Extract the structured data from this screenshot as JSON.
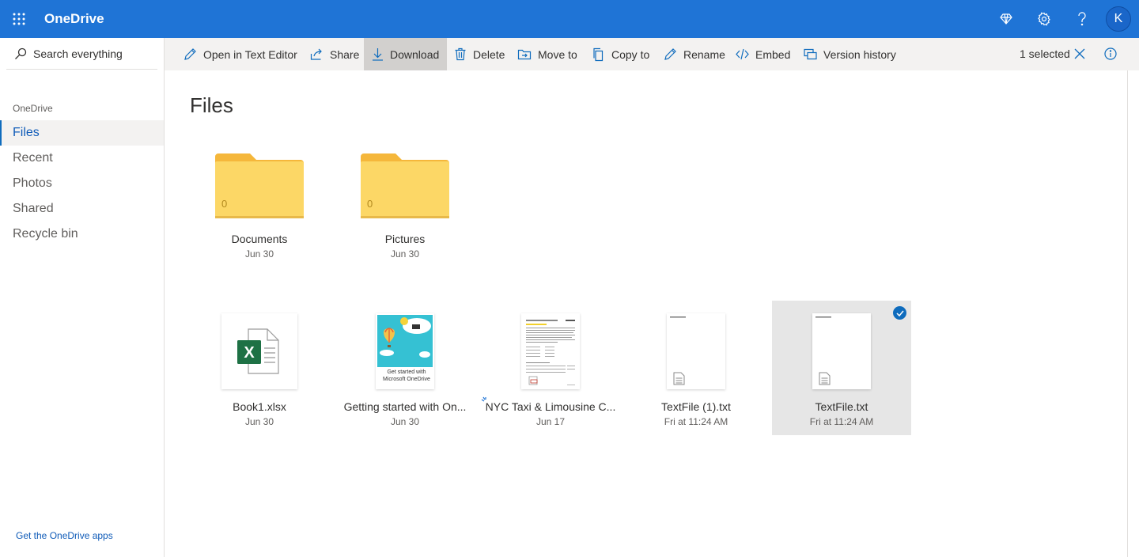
{
  "app": {
    "brand": "OneDrive",
    "avatar_initial": "K",
    "accent_color": "#1f74d6"
  },
  "header": {
    "icons": [
      "waffle-icon",
      "premium-diamond-icon",
      "settings-gear-icon",
      "help-icon"
    ]
  },
  "sidebar": {
    "search_placeholder": "Search everything",
    "section_label": "OneDrive",
    "items": [
      {
        "label": "Files",
        "active": true
      },
      {
        "label": "Recent",
        "active": false
      },
      {
        "label": "Photos",
        "active": false
      },
      {
        "label": "Shared",
        "active": false
      },
      {
        "label": "Recycle bin",
        "active": false
      }
    ],
    "get_apps": "Get the OneDrive apps"
  },
  "commands": {
    "open_text_editor": "Open in Text Editor",
    "share": "Share",
    "download": "Download",
    "delete": "Delete",
    "move_to": "Move to",
    "copy_to": "Copy to",
    "rename": "Rename",
    "embed": "Embed",
    "version_history": "Version history",
    "selected_count": "1 selected"
  },
  "main": {
    "title": "Files",
    "folders": [
      {
        "name": "Documents",
        "date": "Jun 30",
        "count": "0"
      },
      {
        "name": "Pictures",
        "date": "Jun 30",
        "count": "0"
      }
    ],
    "files": [
      {
        "name": "Book1.xlsx",
        "date": "Jun 30",
        "type": "excel",
        "selected": false
      },
      {
        "name": "Getting started with On...",
        "date": "Jun 30",
        "type": "pdf-thumbnail",
        "thumb_text": "Get started with Microsoft OneDrive",
        "selected": false
      },
      {
        "name": "NYC Taxi & Limousine C...",
        "date": "Jun 17",
        "type": "pdf-document",
        "selected": false
      },
      {
        "name": "TextFile (1).txt",
        "date": "Fri at 11:24 AM",
        "type": "text",
        "selected": false
      },
      {
        "name": "TextFile.txt",
        "date": "Fri at 11:24 AM",
        "type": "text",
        "selected": true
      }
    ]
  }
}
